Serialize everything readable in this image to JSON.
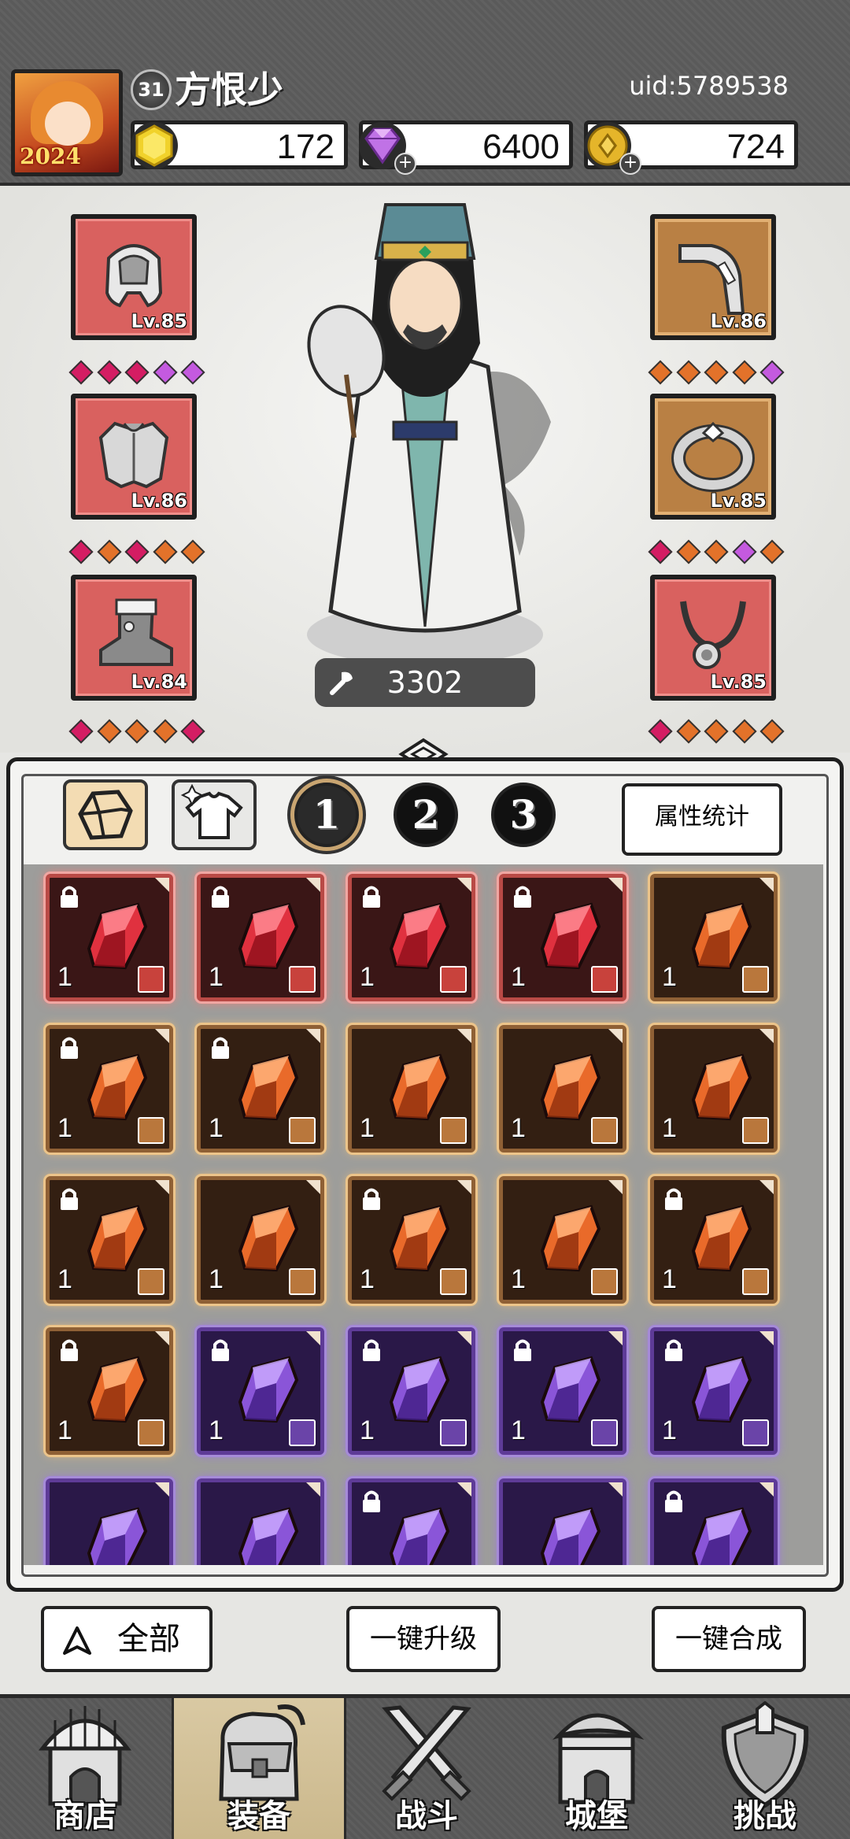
{
  "player": {
    "level": "31",
    "name": "方恨少",
    "uid": "uid:5789538",
    "avatar_year": "2024"
  },
  "resources": [
    {
      "icon": "gold-hexagon-icon",
      "value": "172"
    },
    {
      "icon": "diamond-gem-icon",
      "value": "6400"
    },
    {
      "icon": "gold-coin-icon",
      "value": "724"
    }
  ],
  "equipment_left": [
    {
      "slot": "helmet",
      "level": "Lv.85",
      "color": "red",
      "stars": [
        "p",
        "p",
        "p",
        "v",
        "v"
      ]
    },
    {
      "slot": "armor",
      "level": "Lv.86",
      "color": "red",
      "stars": [
        "p",
        "o",
        "p",
        "o",
        "o"
      ]
    },
    {
      "slot": "boots",
      "level": "Lv.84",
      "color": "red",
      "stars": [
        "p",
        "o",
        "o",
        "o",
        "p"
      ]
    }
  ],
  "equipment_right": [
    {
      "slot": "weapon",
      "level": "Lv.86",
      "color": "gold",
      "stars": [
        "o",
        "o",
        "o",
        "o",
        "v"
      ]
    },
    {
      "slot": "ring",
      "level": "Lv.85",
      "color": "gold",
      "stars": [
        "p",
        "o",
        "o",
        "v",
        "o"
      ]
    },
    {
      "slot": "necklace",
      "level": "Lv.85",
      "color": "red",
      "stars": [
        "p",
        "o",
        "o",
        "o",
        "o"
      ]
    }
  ],
  "power": "3302",
  "inventory": {
    "pages": [
      "1",
      "2",
      "3"
    ],
    "selected_page": "1",
    "stats_button": "属性统计",
    "items": [
      {
        "color": "red",
        "locked": true,
        "count": "1"
      },
      {
        "color": "red",
        "locked": true,
        "count": "1"
      },
      {
        "color": "red",
        "locked": true,
        "count": "1"
      },
      {
        "color": "red",
        "locked": true,
        "count": "1"
      },
      {
        "color": "org",
        "locked": false,
        "count": "1"
      },
      {
        "color": "org",
        "locked": true,
        "count": "1"
      },
      {
        "color": "org",
        "locked": true,
        "count": "1"
      },
      {
        "color": "org",
        "locked": false,
        "count": "1"
      },
      {
        "color": "org",
        "locked": false,
        "count": "1"
      },
      {
        "color": "org",
        "locked": false,
        "count": "1"
      },
      {
        "color": "org",
        "locked": true,
        "count": "1"
      },
      {
        "color": "org",
        "locked": false,
        "count": "1"
      },
      {
        "color": "org",
        "locked": true,
        "count": "1"
      },
      {
        "color": "org",
        "locked": false,
        "count": "1"
      },
      {
        "color": "org",
        "locked": true,
        "count": "1"
      },
      {
        "color": "org",
        "locked": true,
        "count": "1"
      },
      {
        "color": "pur",
        "locked": true,
        "count": "1"
      },
      {
        "color": "pur",
        "locked": true,
        "count": "1"
      },
      {
        "color": "pur",
        "locked": true,
        "count": "1"
      },
      {
        "color": "pur",
        "locked": true,
        "count": "1"
      },
      {
        "color": "pur",
        "locked": false,
        "count": ""
      },
      {
        "color": "pur",
        "locked": false,
        "count": ""
      },
      {
        "color": "pur",
        "locked": true,
        "count": ""
      },
      {
        "color": "pur",
        "locked": false,
        "count": ""
      },
      {
        "color": "pur",
        "locked": true,
        "count": ""
      }
    ]
  },
  "actions": {
    "all": "全部",
    "upgrade_all": "一键升级",
    "merge_all": "一键合成"
  },
  "nav": [
    {
      "label": "商店",
      "icon": "shop-icon"
    },
    {
      "label": "装备",
      "icon": "bag-icon"
    },
    {
      "label": "战斗",
      "icon": "crossed-swords-icon"
    },
    {
      "label": "城堡",
      "icon": "castle-icon"
    },
    {
      "label": "挑战",
      "icon": "shield-icon"
    }
  ]
}
